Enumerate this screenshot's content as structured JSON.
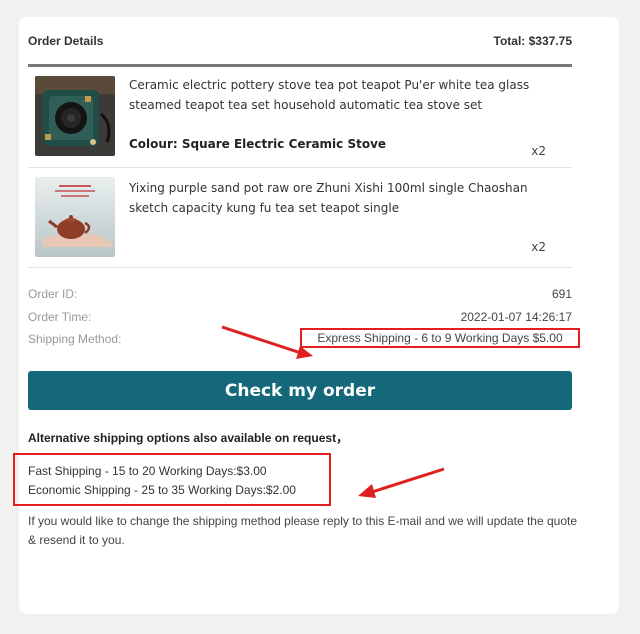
{
  "order": {
    "header_label": "Order Details",
    "total_label": "Total: $337.75"
  },
  "items": [
    {
      "title": "Ceramic electric pottery stove tea pot teapot Pu'er white tea glass steamed teapot tea set household automatic tea stove set",
      "variant": "Colour: Square Electric Ceramic Stove",
      "qty": "x2",
      "thumb_icon": "electric-stove-photo"
    },
    {
      "title": "Yixing purple sand pot raw ore Zhuni Xishi 100ml single Chaoshan sketch capacity kung fu tea set teapot single",
      "variant": "",
      "qty": "x2",
      "thumb_icon": "clay-teapot-photo"
    }
  ],
  "info": {
    "order_id_label": "Order ID:",
    "order_id": "691",
    "order_time_label": "Order Time:",
    "order_time": "2022-01-07 14:26:17",
    "shipping_label": "Shipping Method:",
    "shipping_value": "Express Shipping - 6 to 9 Working Days $5.00"
  },
  "cta": {
    "label": "Check my order",
    "color": "#15677a"
  },
  "alternatives": {
    "heading": "Alternative shipping options also available on request，",
    "options": [
      "Fast Shipping - 15 to 20 Working Days:$3.00",
      "Economic Shipping - 25 to 35 Working Days:$2.00"
    ]
  },
  "note": "If you would like to change the shipping method please reply to this E-mail and we will update the quote & resend it to you.",
  "annotation_color": "#e02020"
}
